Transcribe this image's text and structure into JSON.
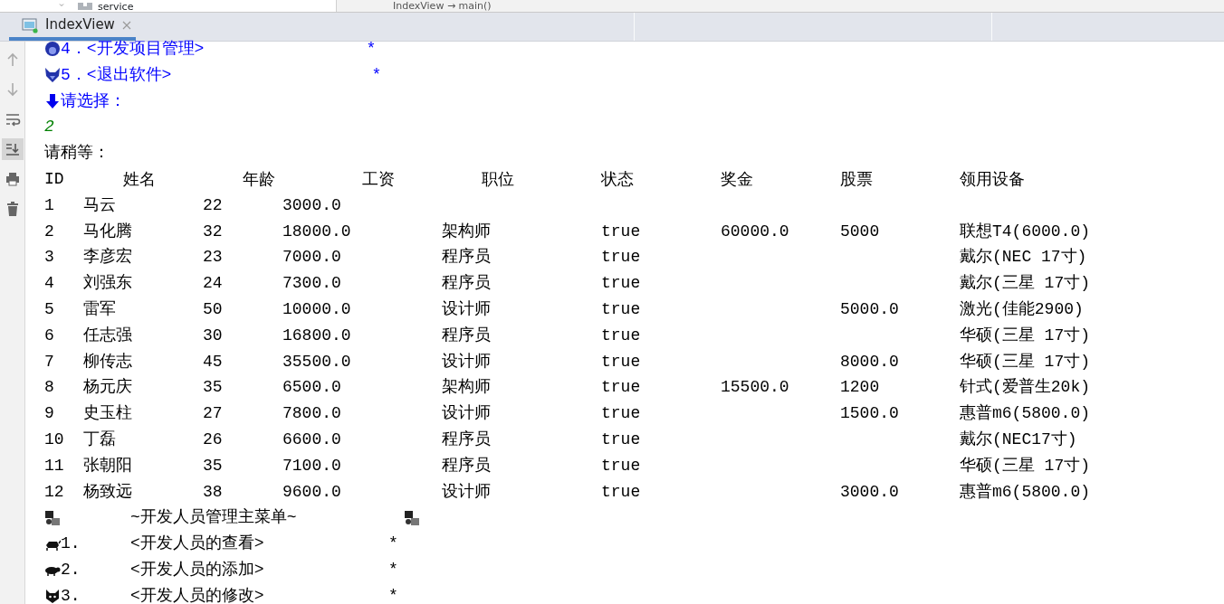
{
  "project_tree": {
    "item": "service"
  },
  "breadcrumb": "IndexView → main()",
  "run_tabs": [
    {
      "label": "IndexView",
      "selected": true
    }
  ],
  "console": {
    "menu_tail": [
      {
        "number": "4．",
        "label": "<开发项目管理>",
        "mark": "*"
      },
      {
        "number": "5．",
        "label": "<退出软件>",
        "mark": "*"
      }
    ],
    "prompt": "请选择：",
    "input": "2",
    "wait": "请稍等：",
    "table": {
      "columns": [
        "ID",
        "姓名",
        "年龄",
        "工资",
        "职位",
        "状态",
        "奖金",
        "股票",
        "领用设备"
      ],
      "rows": [
        {
          "id": "1",
          "name": "马云",
          "age": "22",
          "salary": "3000.0"
        },
        {
          "id": "2",
          "name": "马化腾",
          "age": "32",
          "salary": "18000.0",
          "position": "架构师",
          "status": "true",
          "bonus": "60000.0",
          "stock": "5000",
          "equipment": "联想T4(6000.0)"
        },
        {
          "id": "3",
          "name": "李彦宏",
          "age": "23",
          "salary": "7000.0",
          "position": "程序员",
          "status": "true",
          "equipment": "戴尔(NEC 17寸)"
        },
        {
          "id": "4",
          "name": "刘强东",
          "age": "24",
          "salary": "7300.0",
          "position": "程序员",
          "status": "true",
          "equipment": "戴尔(三星 17寸)"
        },
        {
          "id": "5",
          "name": "雷军",
          "age": "50",
          "salary": "10000.0",
          "position": "设计师",
          "status": "true",
          "stock": "5000.0",
          "equipment": "激光(佳能2900)"
        },
        {
          "id": "6",
          "name": "任志强",
          "age": "30",
          "salary": "16800.0",
          "position": "程序员",
          "status": "true",
          "equipment": "华硕(三星 17寸)"
        },
        {
          "id": "7",
          "name": "柳传志",
          "age": "45",
          "salary": "35500.0",
          "position": "设计师",
          "status": "true",
          "stock": "8000.0",
          "equipment": "华硕(三星 17寸)"
        },
        {
          "id": "8",
          "name": "杨元庆",
          "age": "35",
          "salary": "6500.0",
          "position": "架构师",
          "status": "true",
          "bonus": "15500.0",
          "stock": "1200",
          "equipment": "针式(爱普生20k)"
        },
        {
          "id": "9",
          "name": "史玉柱",
          "age": "27",
          "salary": "7800.0",
          "position": "设计师",
          "status": "true",
          "stock": "1500.0",
          "equipment": "惠普m6(5800.0)"
        },
        {
          "id": "10",
          "name": "丁磊",
          "age": "26",
          "salary": "6600.0",
          "position": "程序员",
          "status": "true",
          "equipment": "戴尔(NEC17寸)"
        },
        {
          "id": "11",
          "name": "张朝阳",
          "age": "35",
          "salary": "7100.0",
          "position": "程序员",
          "status": "true",
          "equipment": "华硕(三星 17寸)"
        },
        {
          "id": "12",
          "name": "杨致远",
          "age": "38",
          "salary": "9600.0",
          "position": "设计师",
          "status": "true",
          "stock": "3000.0",
          "equipment": "惠普m6(5800.0)"
        }
      ]
    },
    "menu": {
      "title": "~开发人员管理主菜单~",
      "items": [
        {
          "number": "1.",
          "label": "<开发人员的查看>",
          "mark": "*"
        },
        {
          "number": "2.",
          "label": "<开发人员的添加>",
          "mark": "*"
        },
        {
          "number": "3.",
          "label": "<开发人员的修改>",
          "mark": "*"
        }
      ]
    }
  }
}
